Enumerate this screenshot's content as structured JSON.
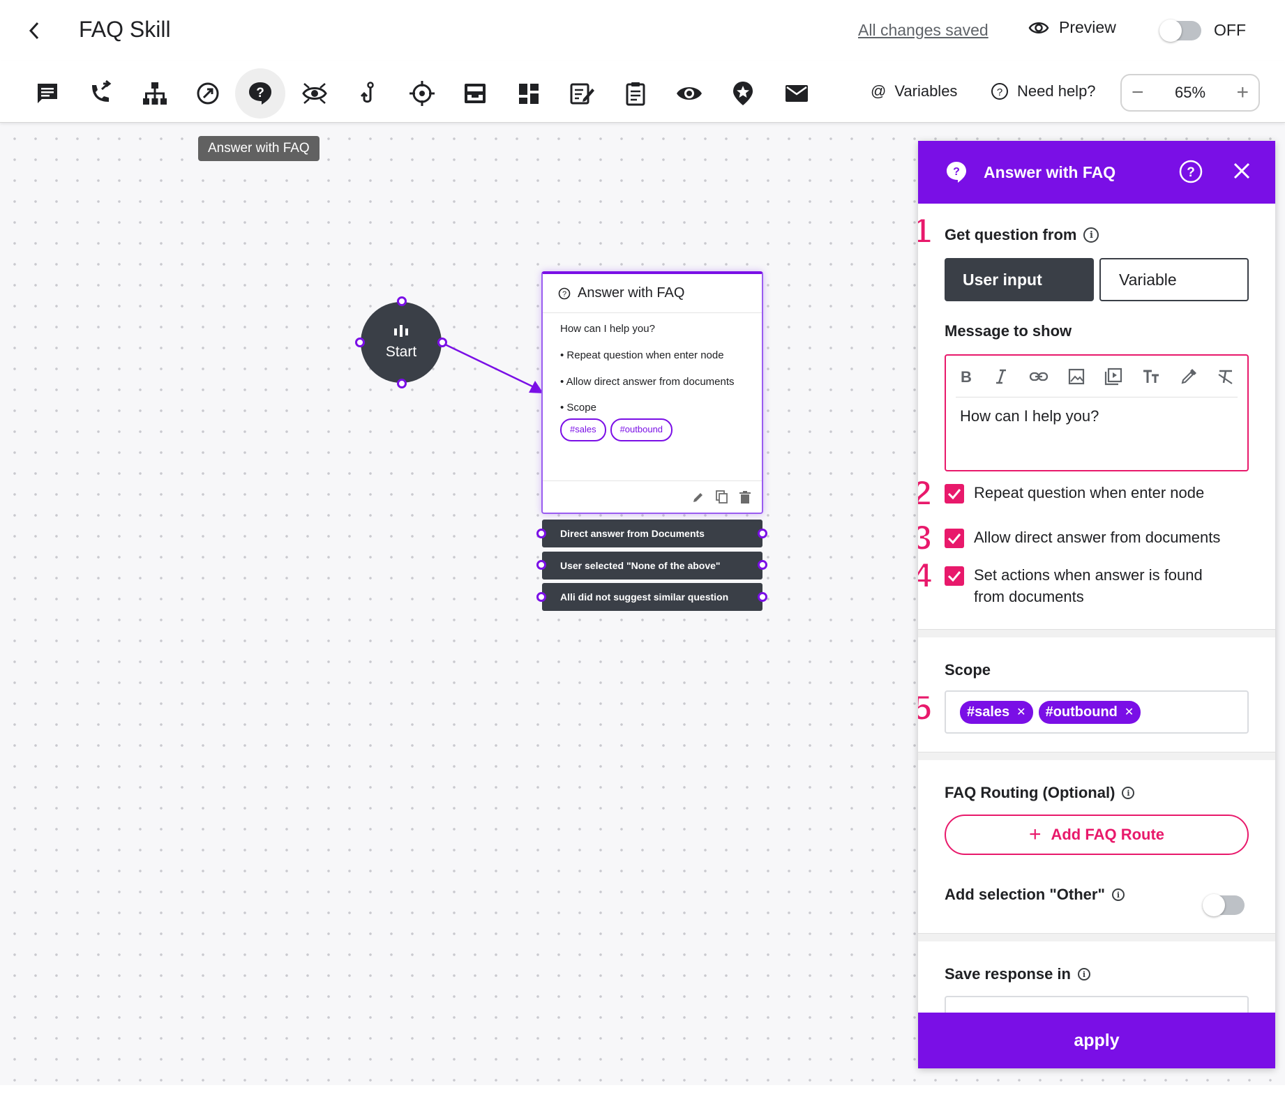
{
  "header": {
    "title": "FAQ Skill",
    "saved_status": "All changes saved",
    "preview_label": "Preview",
    "toggle_label": "OFF"
  },
  "toolbar": {
    "tools": [
      {
        "icon": "chat-icon"
      },
      {
        "icon": "phone-forward-icon"
      },
      {
        "icon": "hierarchy-icon"
      },
      {
        "icon": "compass-icon"
      },
      {
        "icon": "question-icon",
        "active": true
      },
      {
        "icon": "eye-scan-icon"
      },
      {
        "icon": "hook-icon"
      },
      {
        "icon": "crosshair-icon"
      },
      {
        "icon": "inbox-icon"
      },
      {
        "icon": "dashboard-icon"
      },
      {
        "icon": "edit-note-icon"
      },
      {
        "icon": "clipboard-icon"
      },
      {
        "icon": "eye-icon"
      },
      {
        "icon": "star-pin-icon"
      },
      {
        "icon": "mail-icon"
      }
    ],
    "variables_label": "Variables",
    "help_label": "Need help?",
    "zoom_value": "65%"
  },
  "canvas": {
    "tooltip": "Answer with FAQ",
    "start_label": "Start",
    "card": {
      "title": "Answer with FAQ",
      "message": "How can I help you?",
      "options": [
        "• Repeat question when enter node",
        "• Allow direct answer from documents",
        "• Scope"
      ],
      "tags": [
        "#sales",
        "#outbound"
      ]
    },
    "outlets": [
      "Direct answer from Documents",
      "User selected \"None of the above\"",
      "Alli did not suggest similar question"
    ]
  },
  "panel": {
    "title": "Answer with FAQ",
    "get_question_label": "Get question from",
    "source_options": [
      "User input",
      "Variable"
    ],
    "selected_source": "User input",
    "message_label": "Message to show",
    "message_value": "How can I help you?",
    "checkboxes": [
      {
        "label": "Repeat question when enter node",
        "checked": true
      },
      {
        "label": "Allow direct answer from documents",
        "checked": true
      },
      {
        "label": "Set actions when answer is found from documents",
        "checked": true
      }
    ],
    "scope_label": "Scope",
    "scope_tags": [
      "#sales",
      "#outbound"
    ],
    "routing_label": "FAQ Routing (Optional)",
    "add_route_label": "Add FAQ Route",
    "other_label": "Add selection \"Other\"",
    "other_enabled": false,
    "save_response_label": "Save response in",
    "apply_label": "apply"
  },
  "annotations": [
    "1",
    "2",
    "3",
    "4",
    "5"
  ],
  "colors": {
    "accent_purple": "#7a0fe6",
    "accent_pink": "#e8196b",
    "dark_node": "#3a3f47"
  }
}
